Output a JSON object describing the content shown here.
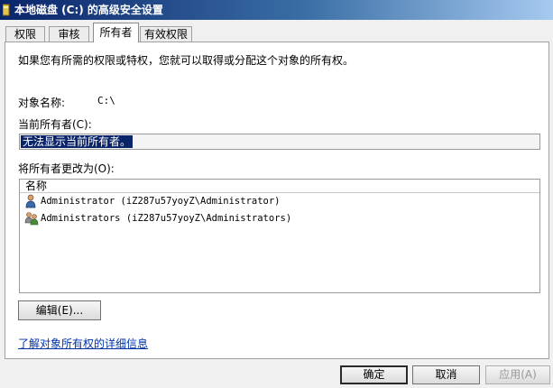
{
  "window": {
    "title": "本地磁盘 (C:) 的高级安全设置"
  },
  "tabs": [
    {
      "label": "权限"
    },
    {
      "label": "审核"
    },
    {
      "label": "所有者",
      "active": true
    },
    {
      "label": "有效权限"
    }
  ],
  "owner_tab": {
    "intro": "如果您有所需的权限或特权，您就可以取得或分配这个对象的所有权。",
    "object_name_label": "对象名称:",
    "object_name_value": "C:\\",
    "current_owner_label": "当前所有者(C):",
    "current_owner_value": "无法显示当前所有者。",
    "change_owner_label": "将所有者更改为(O):",
    "list_header": "名称",
    "list_items": [
      {
        "text": "Administrator (iZ287u57yoyZ\\Administrator)",
        "icon": "user-icon"
      },
      {
        "text": "Administrators (iZ287u57yoyZ\\Administrators)",
        "icon": "group-icon"
      }
    ],
    "edit_button": "编辑(E)...",
    "learn_link": "了解对象所有权的详细信息"
  },
  "buttons": {
    "ok": "确定",
    "cancel": "取消",
    "apply": "应用(A)"
  },
  "colors": {
    "title_gradient_start": "#0a246a",
    "selection": "#0a246a",
    "link": "#0033aa"
  }
}
